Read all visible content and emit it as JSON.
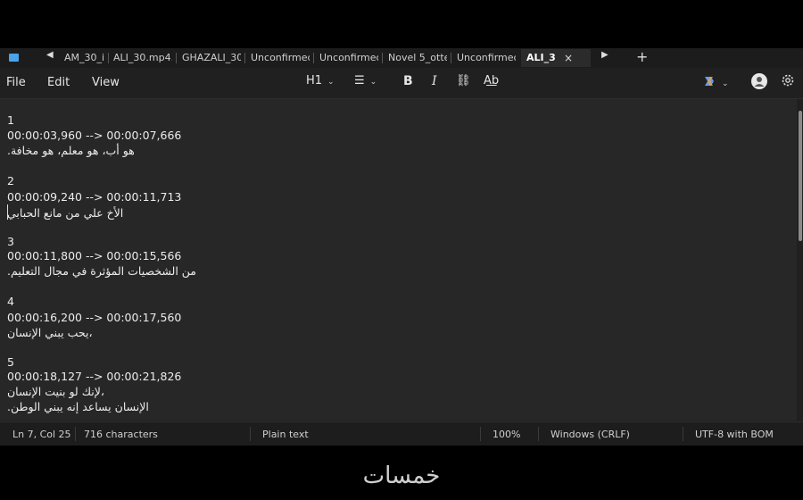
{
  "tabs": {
    "items": [
      "AM_30_i",
      "ALI_30.mp4.",
      "GHAZALI_30",
      "Unconfirmec",
      "Unconfirmec",
      "Novel 5_otte",
      "Unconfirmec"
    ],
    "active": "ALI_3",
    "new_tab": "+",
    "close": "×",
    "scroll_left": "◀",
    "scroll_right": "▶"
  },
  "menu": {
    "file": "File",
    "edit": "Edit",
    "view": "View"
  },
  "toolbar": {
    "heading": "H1",
    "bold": "B",
    "italic": "I",
    "link": "⛓",
    "spell": "A͟b",
    "list": "☰"
  },
  "document": {
    "lines": [
      "1",
      "00:00:03,960 --> 00:00:07,666",
      ".هو أب، هو معلم، هو مخافة",
      "",
      "2",
      "00:00:09,240 --> 00:00:11,713",
      "الأخ علي من مانع الحبابي",
      "",
      "3",
      "00:00:11,800 --> 00:00:15,566",
      ".من الشخصيات المؤثرة في مجال التعليم",
      "",
      "4",
      "00:00:16,200 --> 00:00:17,560",
      "يحب يبني الإنسان،",
      "",
      "5",
      "00:00:18,127 --> 00:00:21,826",
      "لإنك لو بنيت الإنسان،",
      ".الإنسان يساعد إنه يبني الوطن"
    ]
  },
  "status": {
    "position": "Ln 7, Col 25",
    "characters": "716 characters",
    "format": "Plain text",
    "zoom": "100%",
    "line_ending": "Windows (CRLF)",
    "encoding": "UTF-8 with BOM"
  },
  "watermark": "خمسات"
}
